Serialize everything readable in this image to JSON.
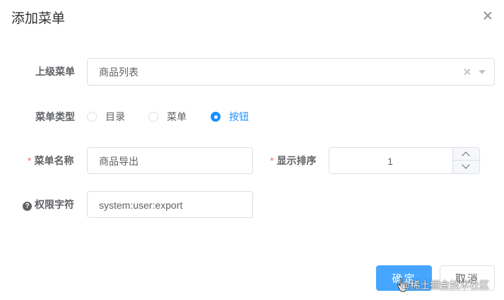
{
  "dialog": {
    "title": "添加菜单"
  },
  "form": {
    "parent_menu": {
      "label": "上级菜单",
      "value": "商品列表"
    },
    "menu_type": {
      "label": "菜单类型",
      "options": [
        {
          "label": "目录",
          "checked": false
        },
        {
          "label": "菜单",
          "checked": false
        },
        {
          "label": "按钮",
          "checked": true
        }
      ]
    },
    "menu_name": {
      "required_mark": "*",
      "label": "菜单名称",
      "value": "商品导出"
    },
    "display_order": {
      "required_mark": "*",
      "label": "显示排序",
      "value": "1"
    },
    "permission": {
      "help_glyph": "?",
      "label": "权限字符",
      "value": "system:user:export"
    }
  },
  "footer": {
    "confirm_label": "确定",
    "cancel_label": "取消",
    "watermark": "@稀土掘金技术社区"
  },
  "colors": {
    "primary": "#1890ff",
    "primary_button": "#46a6ff",
    "required": "#f56c6c",
    "border": "#dcdfe6",
    "text": "#606266"
  }
}
